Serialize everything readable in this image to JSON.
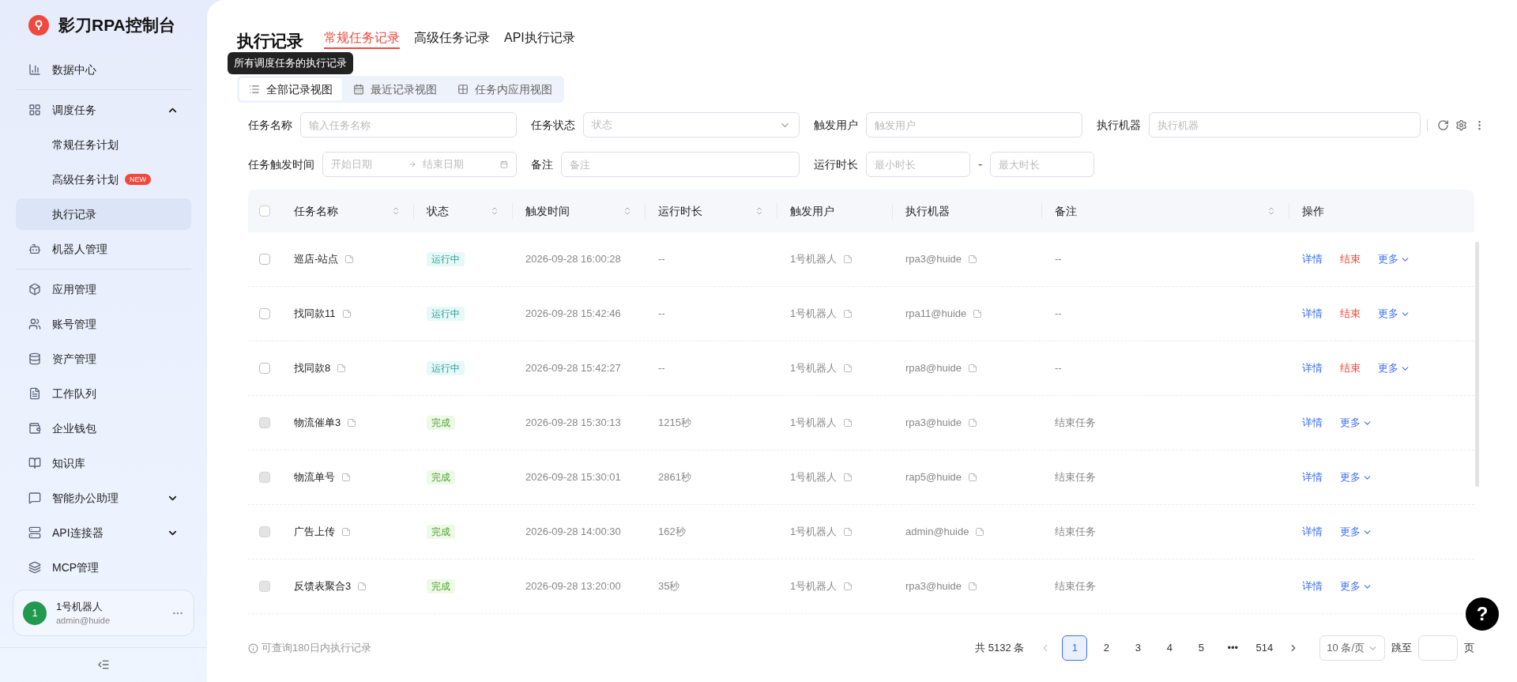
{
  "brand": {
    "title": "影刀RPA控制台"
  },
  "sidebar": {
    "items": [
      {
        "label": "数据中心",
        "divider_after": true
      },
      {
        "label": "调度任务",
        "expanded": true,
        "children": [
          {
            "label": "常规任务计划",
            "selected": false
          },
          {
            "label": "高级任务计划",
            "badge": "NEW",
            "selected": false
          },
          {
            "label": "执行记录",
            "selected": true
          }
        ]
      },
      {
        "label": "机器人管理",
        "divider_after": true
      },
      {
        "label": "应用管理"
      },
      {
        "label": "账号管理"
      },
      {
        "label": "资产管理"
      },
      {
        "label": "工作队列"
      },
      {
        "label": "企业钱包"
      },
      {
        "label": "知识库"
      },
      {
        "label": "智能办公助理",
        "expanded": false
      },
      {
        "label": "API连接器",
        "expanded": false
      },
      {
        "label": "MCP管理"
      }
    ],
    "user": {
      "avatar": "1",
      "name": "1号机器人",
      "email": "admin@huide"
    }
  },
  "page": {
    "title": "执行记录",
    "tabs": [
      {
        "label": "常规任务记录",
        "selected": true
      },
      {
        "label": "高级任务记录",
        "selected": false
      },
      {
        "label": "API执行记录",
        "selected": false
      }
    ],
    "tooltip": "所有调度任务的执行记录",
    "views": [
      {
        "label": "全部记录视图",
        "selected": true
      },
      {
        "label": "最近记录视图",
        "selected": false
      },
      {
        "label": "任务内应用视图",
        "selected": false
      }
    ]
  },
  "filters": [
    {
      "label": "任务名称",
      "kind": "input",
      "placeholder": "输入任务名称"
    },
    {
      "label": "任务状态",
      "kind": "select",
      "placeholder": "状态"
    },
    {
      "label": "触发用户",
      "kind": "input",
      "placeholder": "触发用户"
    },
    {
      "label": "执行机器",
      "kind": "input",
      "placeholder": "执行机器"
    },
    {
      "label": "任务触发时间",
      "kind": "daterange",
      "placeholder": "开始日期",
      "placeholder_end": "结束日期"
    },
    {
      "label": "备注",
      "kind": "input",
      "placeholder": "备注"
    },
    {
      "label": "运行时长",
      "kind": "range",
      "placeholder": "最小时长",
      "separator": "-",
      "placeholder_end": "最大时长"
    }
  ],
  "table": {
    "header_checked": false,
    "columns": [
      {
        "label": "任务名称",
        "sortable": true
      },
      {
        "label": "状态",
        "sortable": true
      },
      {
        "label": "触发时间",
        "sortable": true
      },
      {
        "label": "运行时长",
        "sortable": true
      },
      {
        "label": "触发用户",
        "sortable": false
      },
      {
        "label": "执行机器",
        "sortable": false
      },
      {
        "label": "备注",
        "sortable": true
      },
      {
        "label": "操作",
        "sortable": false
      }
    ],
    "rows": [
      {
        "checked": false,
        "disabled": false,
        "name": "巡店-站点",
        "status": "运行中",
        "kind": "running",
        "time": "2026-09-28 16:00:28",
        "duration": "--",
        "user": "1号机器人",
        "machine": "rpa3@huide",
        "note": "--",
        "actions": [
          {
            "label": "详情",
            "kind": "link"
          },
          {
            "label": "结束",
            "kind": "danger"
          },
          {
            "label": "更多",
            "kind": "more"
          }
        ]
      },
      {
        "checked": false,
        "disabled": false,
        "name": "找同款11",
        "status": "运行中",
        "kind": "running",
        "time": "2026-09-28 15:42:46",
        "duration": "--",
        "user": "1号机器人",
        "machine": "rpa11@huide",
        "note": "--",
        "actions": [
          {
            "label": "详情",
            "kind": "link"
          },
          {
            "label": "结束",
            "kind": "danger"
          },
          {
            "label": "更多",
            "kind": "more"
          }
        ]
      },
      {
        "checked": false,
        "disabled": false,
        "name": "找同款8",
        "status": "运行中",
        "kind": "running",
        "time": "2026-09-28 15:42:27",
        "duration": "--",
        "user": "1号机器人",
        "machine": "rpa8@huide",
        "note": "--",
        "actions": [
          {
            "label": "详情",
            "kind": "link"
          },
          {
            "label": "结束",
            "kind": "danger"
          },
          {
            "label": "更多",
            "kind": "more"
          }
        ]
      },
      {
        "checked": false,
        "disabled": true,
        "name": "物流催单3",
        "status": "完成",
        "kind": "done",
        "time": "2026-09-28 15:30:13",
        "duration": "1215秒",
        "user": "1号机器人",
        "machine": "rpa3@huide",
        "note": "结束任务",
        "actions": [
          {
            "label": "详情",
            "kind": "link"
          },
          {
            "label": "更多",
            "kind": "more"
          }
        ]
      },
      {
        "checked": false,
        "disabled": true,
        "name": "物流单号",
        "status": "完成",
        "kind": "done",
        "time": "2026-09-28 15:30:01",
        "duration": "2861秒",
        "user": "1号机器人",
        "machine": "rap5@huide",
        "note": "结束任务",
        "actions": [
          {
            "label": "详情",
            "kind": "link"
          },
          {
            "label": "更多",
            "kind": "more"
          }
        ]
      },
      {
        "checked": false,
        "disabled": true,
        "name": "广告上传",
        "status": "完成",
        "kind": "done",
        "time": "2026-09-28 14:00:30",
        "duration": "162秒",
        "user": "1号机器人",
        "machine": "admin@huide",
        "note": "结束任务",
        "actions": [
          {
            "label": "详情",
            "kind": "link"
          },
          {
            "label": "更多",
            "kind": "more"
          }
        ]
      },
      {
        "checked": false,
        "disabled": true,
        "name": "反馈表聚合3",
        "status": "完成",
        "kind": "done",
        "time": "2026-09-28 13:20:00",
        "duration": "35秒",
        "user": "1号机器人",
        "machine": "rpa3@huide",
        "note": "结束任务",
        "actions": [
          {
            "label": "详情",
            "kind": "link"
          },
          {
            "label": "更多",
            "kind": "more"
          }
        ]
      }
    ]
  },
  "footer": {
    "hint": "可查询180日内执行记录",
    "total": "共 5132 条",
    "pages": [
      {
        "label": "1",
        "selected": true
      },
      {
        "label": "2",
        "selected": false
      },
      {
        "label": "3",
        "selected": false
      },
      {
        "label": "4",
        "selected": false
      },
      {
        "label": "5",
        "selected": false
      },
      {
        "label": "•••",
        "selected": false
      },
      {
        "label": "514",
        "selected": false
      }
    ],
    "page_size": "10 条/页",
    "jump_label": "跳至",
    "jump_suffix": "页"
  },
  "help": {
    "label": "?"
  }
}
